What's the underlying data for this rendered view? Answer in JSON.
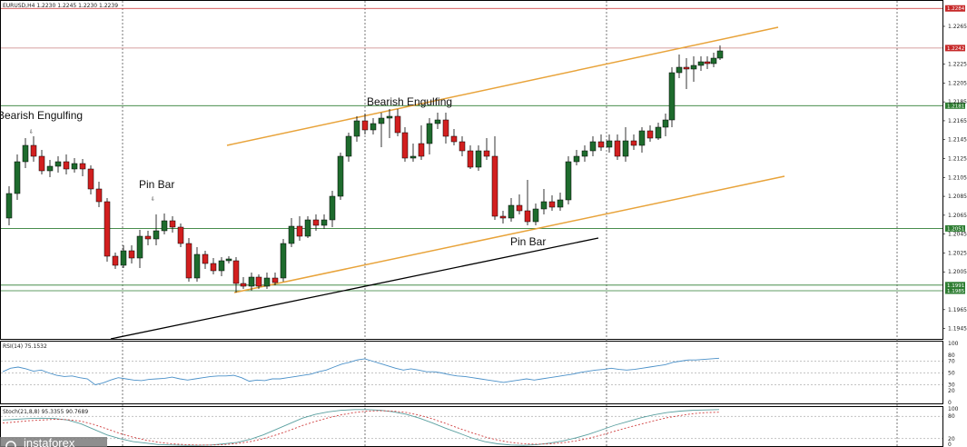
{
  "header": {
    "symbol_info": "EURUSD,H4  1.2230 1.2245 1.2230 1.2239"
  },
  "colors": {
    "bull": "#1e6b2d",
    "bear": "#d21f1f",
    "channel": "#e8a33a",
    "trendline": "#000000",
    "support": "#2e7d32",
    "resistance": "#c62828",
    "rsi": "#4a90c8",
    "stoch_main": "#5aa0a0",
    "stoch_signal": "#d04040"
  },
  "price_axis": {
    "min": 1.1935,
    "max": 1.229,
    "ticks": [
      "1.2265",
      "1.2225",
      "1.2205",
      "1.2185",
      "1.2165",
      "1.2145",
      "1.2125",
      "1.2105",
      "1.2085",
      "1.2065",
      "1.2045",
      "1.2025",
      "1.2005",
      "1.1965",
      "1.1945"
    ]
  },
  "levels": [
    {
      "price": 1.2284,
      "label": "1.2284",
      "kind": "resistance"
    },
    {
      "price": 1.2242,
      "label": "1.2242",
      "kind": "current"
    },
    {
      "price": 1.2181,
      "label": "1.2181",
      "kind": "support"
    },
    {
      "price": 1.2051,
      "label": "1.2051",
      "kind": "support"
    },
    {
      "price": 1.1991,
      "label": "1.1991",
      "kind": "support"
    },
    {
      "price": 1.1985,
      "label": "1.1985",
      "kind": "support"
    }
  ],
  "annotations": [
    {
      "text": "Bearish Engulfing",
      "id": "bearish-engulfing-left"
    },
    {
      "text": "Pin Bar",
      "id": "pin-bar-left"
    },
    {
      "text": "Bearish Engulfing",
      "id": "bearish-engulfing-mid"
    },
    {
      "text": "Pin Bar",
      "id": "pin-bar-right"
    }
  ],
  "rsi": {
    "label": "RSI(14) 75.1532",
    "min": 0,
    "max": 100,
    "ticks": [
      "100",
      "80",
      "70",
      "50",
      "30",
      "20",
      "0"
    ],
    "values": [
      52,
      58,
      60,
      57,
      53,
      55,
      50,
      46,
      44,
      45,
      42,
      40,
      30,
      33,
      38,
      42,
      40,
      38,
      37,
      39,
      40,
      41,
      43,
      40,
      38,
      40,
      42,
      44,
      45,
      45,
      46,
      42,
      36,
      38,
      37,
      40,
      40,
      42,
      44,
      46,
      48,
      52,
      55,
      60,
      65,
      68,
      72,
      74,
      70,
      66,
      62,
      58,
      55,
      57,
      55,
      52,
      52,
      50,
      47,
      45,
      44,
      42,
      40,
      38,
      36,
      34,
      36,
      38,
      40,
      38,
      40,
      42,
      44,
      46,
      48,
      51,
      53,
      55,
      56,
      58,
      56,
      55,
      56,
      58,
      60,
      62,
      64,
      68,
      70,
      72,
      72,
      73,
      74,
      75
    ]
  },
  "stoch": {
    "label": "Stoch(21,8,8) 95.3355 90.7689",
    "min": 0,
    "max": 100,
    "ticks": [
      "100",
      "80",
      "20",
      "0"
    ],
    "main": [
      70,
      72,
      74,
      75,
      74,
      70,
      60,
      45,
      30,
      20,
      12,
      8,
      4,
      3,
      2,
      2,
      3,
      6,
      10,
      18,
      30,
      45,
      60,
      75,
      85,
      92,
      96,
      98,
      98,
      96,
      92,
      85,
      75,
      62,
      48,
      35,
      22,
      12,
      6,
      3,
      2,
      4,
      8,
      14,
      22,
      32,
      44,
      56,
      66,
      76,
      84,
      90,
      94,
      96,
      97,
      98
    ],
    "signal": [
      62,
      65,
      68,
      70,
      72,
      71,
      67,
      58,
      46,
      34,
      24,
      16,
      10,
      6,
      4,
      3,
      3,
      4,
      7,
      12,
      20,
      30,
      42,
      55,
      66,
      76,
      84,
      90,
      94,
      95,
      94,
      90,
      83,
      73,
      61,
      48,
      36,
      25,
      16,
      10,
      6,
      5,
      6,
      9,
      14,
      21,
      30,
      40,
      50,
      59,
      68,
      76,
      82,
      87,
      90,
      91
    ]
  },
  "watermark": "instaforex"
}
